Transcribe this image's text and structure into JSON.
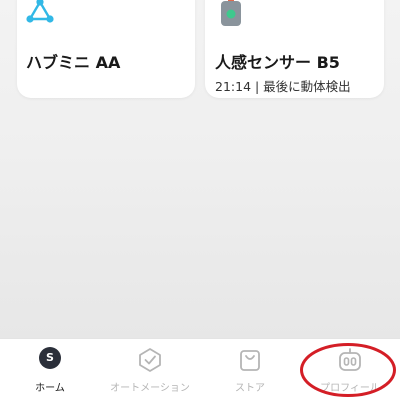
{
  "colors": {
    "accent_hub": "#32b8e6",
    "sensor_body": "#8a949c",
    "sensor_light": "#3ec98d",
    "sensor_top": "#e06a4e",
    "highlight": "#d41e26",
    "tab_inactive": "#b5b5b5",
    "tab_active": "#1a1a1a"
  },
  "devices": [
    {
      "icon": "hub-mini-icon",
      "name": "ハブミニ AA"
    },
    {
      "icon": "motion-sensor-icon",
      "name": "人感センサー B5",
      "status": "21:14 | 最後に動体検出"
    }
  ],
  "tabbar": {
    "tabs": [
      {
        "icon": "avatar",
        "avatar_letter": "S",
        "label": "ホーム",
        "active": true
      },
      {
        "icon": "check-shield-icon",
        "label": "オートメーション",
        "active": false
      },
      {
        "icon": "shopping-bag-icon",
        "label": "ストア",
        "active": false
      },
      {
        "icon": "robot-face-icon",
        "label": "プロフィール",
        "active": false
      }
    ]
  },
  "highlight": {
    "target": "tab-profile",
    "shape": "red-ellipse"
  }
}
